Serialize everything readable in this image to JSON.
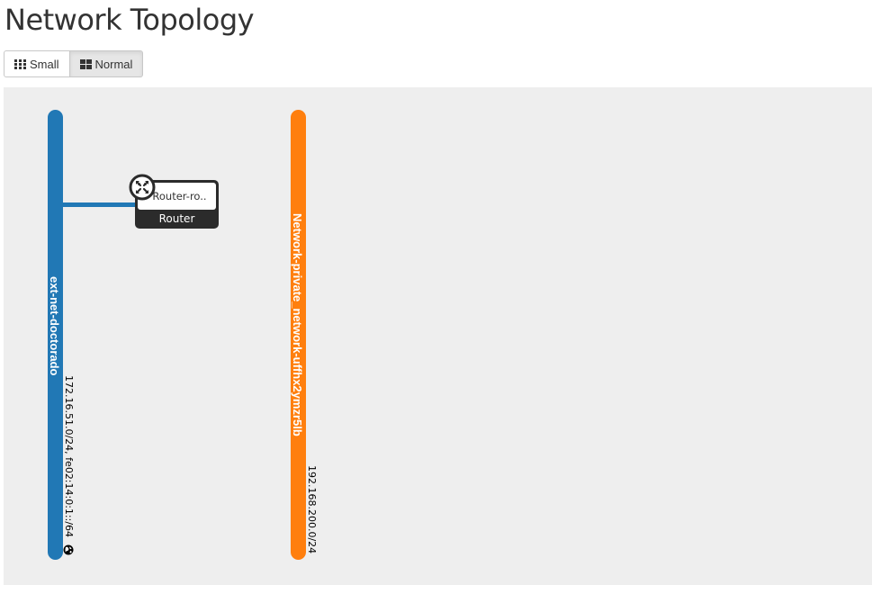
{
  "page": {
    "title": "Network Topology"
  },
  "toolbar": {
    "small_label": "Small",
    "normal_label": "Normal",
    "selected": "Normal"
  },
  "topology": {
    "networks": [
      {
        "name": "ext-net-doctorado",
        "cidr": "172.16.51.0/24, fe02:14:0:1::/64",
        "color": "#2178b5",
        "external": true,
        "icon": "globe-icon"
      },
      {
        "name": "Network-private_network-uffhx2ymzr5lb",
        "cidr": "192.168.200.0/24",
        "color": "#ff7f0e",
        "external": false
      }
    ],
    "routers": [
      {
        "name": "Router-ro..",
        "type_label": "Router",
        "icon": "router-icon",
        "connected_to": "ext-net-doctorado"
      }
    ]
  },
  "colors": {
    "canvas_bg": "#eeeeee",
    "router_bg": "#2b2b2b"
  }
}
